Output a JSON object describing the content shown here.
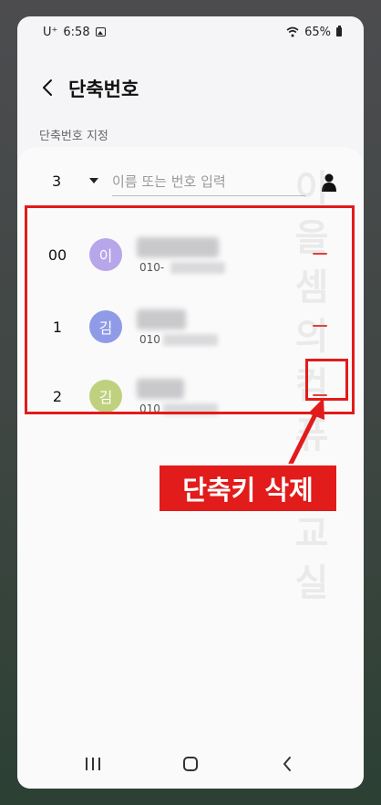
{
  "status_bar": {
    "carrier": "U⁺",
    "time": "6:58",
    "battery": "65%"
  },
  "header": {
    "title": "단축번호",
    "back_icon": "back-arrow-icon"
  },
  "section": {
    "title": "단축번호 지정"
  },
  "input_row": {
    "number": "3",
    "placeholder": "이름 또는 번호 입력",
    "value": ""
  },
  "speed_dials": [
    {
      "number": "00",
      "avatar": "이",
      "avatar_color": "#b7a6ea",
      "phone": "010-"
    },
    {
      "number": "1",
      "avatar": "김",
      "avatar_color": "#8f9be6",
      "phone": "010"
    },
    {
      "number": "2",
      "avatar": "김",
      "avatar_color": "#bfd17e",
      "phone": "010"
    }
  ],
  "annotation": {
    "label": "단축키 삭제",
    "color": "#e21b1b"
  },
  "watermark": [
    "이",
    "을",
    "셈",
    "의",
    "컴",
    "퓨",
    "터",
    "교",
    "실"
  ],
  "nav": {
    "recents": "recents-icon",
    "home": "home-icon",
    "back": "back-icon"
  }
}
